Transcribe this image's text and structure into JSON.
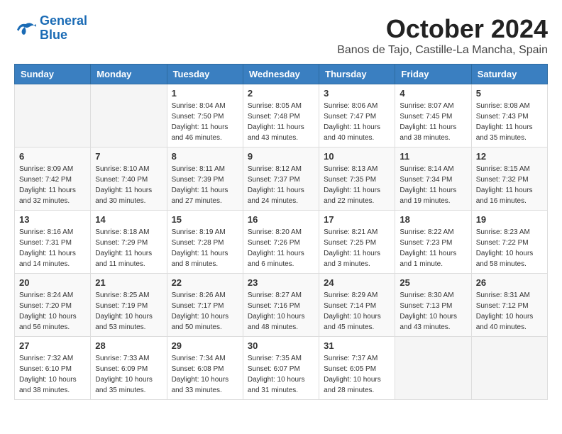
{
  "logo": {
    "line1": "General",
    "line2": "Blue"
  },
  "title": "October 2024",
  "location": "Banos de Tajo, Castille-La Mancha, Spain",
  "headers": [
    "Sunday",
    "Monday",
    "Tuesday",
    "Wednesday",
    "Thursday",
    "Friday",
    "Saturday"
  ],
  "weeks": [
    [
      {
        "day": "",
        "sunrise": "",
        "sunset": "",
        "daylight": ""
      },
      {
        "day": "",
        "sunrise": "",
        "sunset": "",
        "daylight": ""
      },
      {
        "day": "1",
        "sunrise": "Sunrise: 8:04 AM",
        "sunset": "Sunset: 7:50 PM",
        "daylight": "Daylight: 11 hours and 46 minutes."
      },
      {
        "day": "2",
        "sunrise": "Sunrise: 8:05 AM",
        "sunset": "Sunset: 7:48 PM",
        "daylight": "Daylight: 11 hours and 43 minutes."
      },
      {
        "day": "3",
        "sunrise": "Sunrise: 8:06 AM",
        "sunset": "Sunset: 7:47 PM",
        "daylight": "Daylight: 11 hours and 40 minutes."
      },
      {
        "day": "4",
        "sunrise": "Sunrise: 8:07 AM",
        "sunset": "Sunset: 7:45 PM",
        "daylight": "Daylight: 11 hours and 38 minutes."
      },
      {
        "day": "5",
        "sunrise": "Sunrise: 8:08 AM",
        "sunset": "Sunset: 7:43 PM",
        "daylight": "Daylight: 11 hours and 35 minutes."
      }
    ],
    [
      {
        "day": "6",
        "sunrise": "Sunrise: 8:09 AM",
        "sunset": "Sunset: 7:42 PM",
        "daylight": "Daylight: 11 hours and 32 minutes."
      },
      {
        "day": "7",
        "sunrise": "Sunrise: 8:10 AM",
        "sunset": "Sunset: 7:40 PM",
        "daylight": "Daylight: 11 hours and 30 minutes."
      },
      {
        "day": "8",
        "sunrise": "Sunrise: 8:11 AM",
        "sunset": "Sunset: 7:39 PM",
        "daylight": "Daylight: 11 hours and 27 minutes."
      },
      {
        "day": "9",
        "sunrise": "Sunrise: 8:12 AM",
        "sunset": "Sunset: 7:37 PM",
        "daylight": "Daylight: 11 hours and 24 minutes."
      },
      {
        "day": "10",
        "sunrise": "Sunrise: 8:13 AM",
        "sunset": "Sunset: 7:35 PM",
        "daylight": "Daylight: 11 hours and 22 minutes."
      },
      {
        "day": "11",
        "sunrise": "Sunrise: 8:14 AM",
        "sunset": "Sunset: 7:34 PM",
        "daylight": "Daylight: 11 hours and 19 minutes."
      },
      {
        "day": "12",
        "sunrise": "Sunrise: 8:15 AM",
        "sunset": "Sunset: 7:32 PM",
        "daylight": "Daylight: 11 hours and 16 minutes."
      }
    ],
    [
      {
        "day": "13",
        "sunrise": "Sunrise: 8:16 AM",
        "sunset": "Sunset: 7:31 PM",
        "daylight": "Daylight: 11 hours and 14 minutes."
      },
      {
        "day": "14",
        "sunrise": "Sunrise: 8:18 AM",
        "sunset": "Sunset: 7:29 PM",
        "daylight": "Daylight: 11 hours and 11 minutes."
      },
      {
        "day": "15",
        "sunrise": "Sunrise: 8:19 AM",
        "sunset": "Sunset: 7:28 PM",
        "daylight": "Daylight: 11 hours and 8 minutes."
      },
      {
        "day": "16",
        "sunrise": "Sunrise: 8:20 AM",
        "sunset": "Sunset: 7:26 PM",
        "daylight": "Daylight: 11 hours and 6 minutes."
      },
      {
        "day": "17",
        "sunrise": "Sunrise: 8:21 AM",
        "sunset": "Sunset: 7:25 PM",
        "daylight": "Daylight: 11 hours and 3 minutes."
      },
      {
        "day": "18",
        "sunrise": "Sunrise: 8:22 AM",
        "sunset": "Sunset: 7:23 PM",
        "daylight": "Daylight: 11 hours and 1 minute."
      },
      {
        "day": "19",
        "sunrise": "Sunrise: 8:23 AM",
        "sunset": "Sunset: 7:22 PM",
        "daylight": "Daylight: 10 hours and 58 minutes."
      }
    ],
    [
      {
        "day": "20",
        "sunrise": "Sunrise: 8:24 AM",
        "sunset": "Sunset: 7:20 PM",
        "daylight": "Daylight: 10 hours and 56 minutes."
      },
      {
        "day": "21",
        "sunrise": "Sunrise: 8:25 AM",
        "sunset": "Sunset: 7:19 PM",
        "daylight": "Daylight: 10 hours and 53 minutes."
      },
      {
        "day": "22",
        "sunrise": "Sunrise: 8:26 AM",
        "sunset": "Sunset: 7:17 PM",
        "daylight": "Daylight: 10 hours and 50 minutes."
      },
      {
        "day": "23",
        "sunrise": "Sunrise: 8:27 AM",
        "sunset": "Sunset: 7:16 PM",
        "daylight": "Daylight: 10 hours and 48 minutes."
      },
      {
        "day": "24",
        "sunrise": "Sunrise: 8:29 AM",
        "sunset": "Sunset: 7:14 PM",
        "daylight": "Daylight: 10 hours and 45 minutes."
      },
      {
        "day": "25",
        "sunrise": "Sunrise: 8:30 AM",
        "sunset": "Sunset: 7:13 PM",
        "daylight": "Daylight: 10 hours and 43 minutes."
      },
      {
        "day": "26",
        "sunrise": "Sunrise: 8:31 AM",
        "sunset": "Sunset: 7:12 PM",
        "daylight": "Daylight: 10 hours and 40 minutes."
      }
    ],
    [
      {
        "day": "27",
        "sunrise": "Sunrise: 7:32 AM",
        "sunset": "Sunset: 6:10 PM",
        "daylight": "Daylight: 10 hours and 38 minutes."
      },
      {
        "day": "28",
        "sunrise": "Sunrise: 7:33 AM",
        "sunset": "Sunset: 6:09 PM",
        "daylight": "Daylight: 10 hours and 35 minutes."
      },
      {
        "day": "29",
        "sunrise": "Sunrise: 7:34 AM",
        "sunset": "Sunset: 6:08 PM",
        "daylight": "Daylight: 10 hours and 33 minutes."
      },
      {
        "day": "30",
        "sunrise": "Sunrise: 7:35 AM",
        "sunset": "Sunset: 6:07 PM",
        "daylight": "Daylight: 10 hours and 31 minutes."
      },
      {
        "day": "31",
        "sunrise": "Sunrise: 7:37 AM",
        "sunset": "Sunset: 6:05 PM",
        "daylight": "Daylight: 10 hours and 28 minutes."
      },
      {
        "day": "",
        "sunrise": "",
        "sunset": "",
        "daylight": ""
      },
      {
        "day": "",
        "sunrise": "",
        "sunset": "",
        "daylight": ""
      }
    ]
  ]
}
